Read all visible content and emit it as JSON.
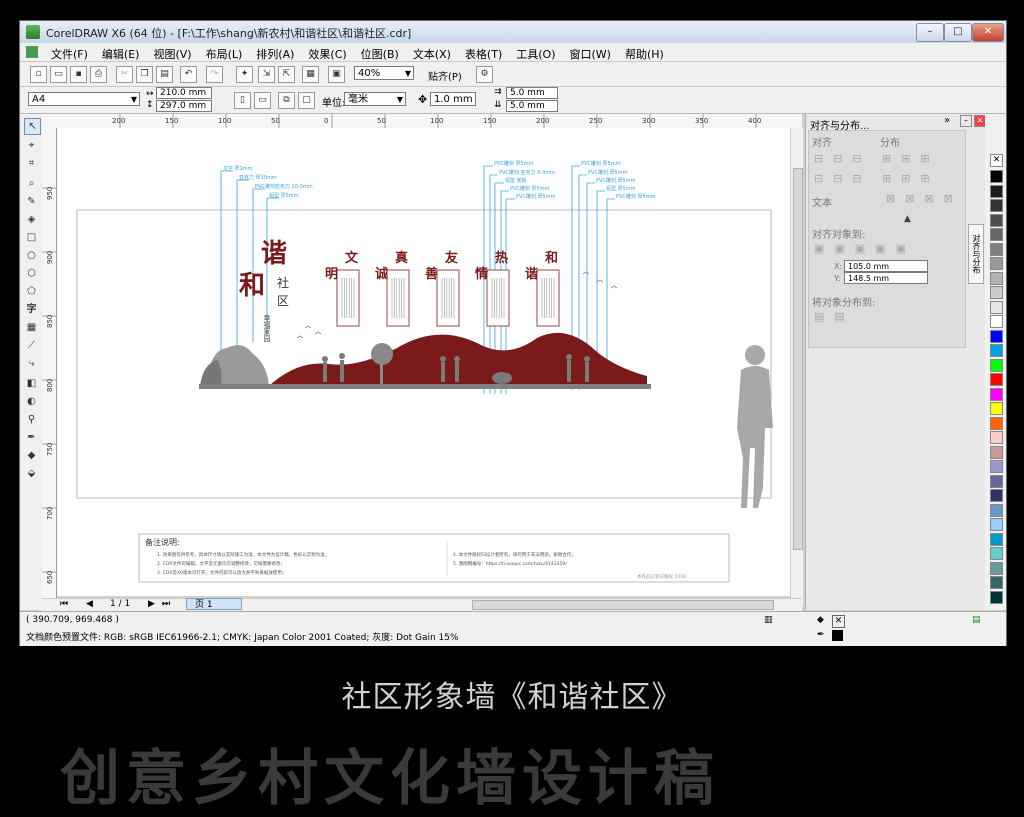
{
  "window": {
    "title": "CorelDRAW X6 (64 位) - [F:\\工作\\shang\\新农村\\和谐社区\\和谐社区.cdr]",
    "controls": {
      "minimize": "–",
      "maximize": "□",
      "close": "✕"
    }
  },
  "menu": [
    "文件(F)",
    "编辑(E)",
    "视图(V)",
    "布局(L)",
    "排列(A)",
    "效果(C)",
    "位图(B)",
    "文本(X)",
    "表格(T)",
    "工具(O)",
    "窗口(W)",
    "帮助(H)"
  ],
  "toolbar": {
    "zoom": "40%",
    "snap": "贴齐(P)"
  },
  "propertybar": {
    "page_size": "A4",
    "width": "210.0 mm",
    "height": "297.0 mm",
    "unit_label": "单位:",
    "unit": "毫米",
    "nudge": "1.0 mm",
    "dup_x": "5.0 mm",
    "dup_y": "5.0 mm"
  },
  "ruler_top": [
    "200",
    "150",
    "100",
    "50",
    "0",
    "50",
    "100",
    "150",
    "200",
    "250",
    "300",
    "350",
    "400"
  ],
  "ruler_left": [
    "950",
    "900",
    "850",
    "800",
    "750",
    "700",
    "650"
  ],
  "design": {
    "title_he": "和",
    "title_xie": "谐",
    "title_she": "社",
    "title_qu": "区",
    "subtitle": "幸福家园",
    "boards": [
      {
        "top": "文",
        "bottom": "明"
      },
      {
        "top": "真",
        "bottom": "诚"
      },
      {
        "top": "友",
        "bottom": "善"
      },
      {
        "top": "热",
        "bottom": "情"
      },
      {
        "top": "和",
        "bottom": "谐"
      }
    ],
    "dim_left": [
      "文字 厚1mm",
      "亚克力 厚10mm",
      "PVC雕刻亚克力 10-3mm",
      "铝型 厚5mm"
    ],
    "dim_mid": [
      "PVC雕刻 厚5mm",
      "PVC雕刻 亚克力 5-3mm",
      "铝型 底板",
      "PVC雕刻 厚5mm",
      "PVC雕刻 厚5mm"
    ],
    "dim_right": [
      "PVC雕刻 厚5mm",
      "PVC雕刻 厚5mm",
      "PVC雕刻 厚5mm",
      "铝型 厚5mm",
      "PVC雕刻 厚5mm"
    ],
    "notes_title": "备注说明:",
    "notes_left": [
      "1. 效果图仅供参考，具体尺寸请以实际施工为准，本文件为设计稿，色彩以实物为准；",
      "2. CDR文件可编辑，文字及元素均可调整修改，可按需要修改；",
      "3. CDR及X6版本可打开，文件内容可以放大并不失真缩放使用；"
    ],
    "notes_right": [
      "4. 本文件版权归设计者所有，请勿用于非法用途，谢谢合作；",
      "5. 我图网编号：https://ti.ooopic.com/tuku/4143359/"
    ],
    "notes_sign": "本作品已登记版权 2018"
  },
  "pages": {
    "current": "1 / 1",
    "tab": "页 1"
  },
  "docker": {
    "title": "对齐与分布...",
    "align_label": "对齐",
    "distribute_label": "分布",
    "text_label": "文本",
    "align_to_label": "对齐对象到:",
    "x_value": "105.0 mm",
    "y_value": "148.5 mm",
    "distribute_to_label": "将对象分布到:",
    "side_tab": "对齐与分布"
  },
  "status": {
    "coords": "( 390.709, 969.468 )",
    "color_profile": "文档颜色预置文件: RGB: sRGB IEC61966-2.1; CMYK: Japan Color 2001 Coated; 灰度: Dot Gain 15%"
  },
  "caption": {
    "title": "社区形象墙《和谐社区》",
    "big": "创意乡村文化墙设计稿"
  },
  "colors": {
    "accent_red": "#7a1a1a",
    "dim_blue": "#35a6d9",
    "gray_figure": "#a8a8a8",
    "palette": [
      "#000000",
      "#1a1a1a",
      "#333333",
      "#4d4d4d",
      "#666666",
      "#808080",
      "#999999",
      "#b3b3b3",
      "#cccccc",
      "#e6e6e6",
      "#ffffff",
      "#0000ff",
      "#00a0e9",
      "#00ff00",
      "#ff0000",
      "#ff00ff",
      "#ffff00",
      "#ff6600",
      "#ffcccc",
      "#cc9999",
      "#9999cc",
      "#666699",
      "#333366",
      "#6699cc",
      "#99ccff",
      "#0099cc",
      "#66cccc",
      "#669999",
      "#336666",
      "#003333"
    ]
  }
}
